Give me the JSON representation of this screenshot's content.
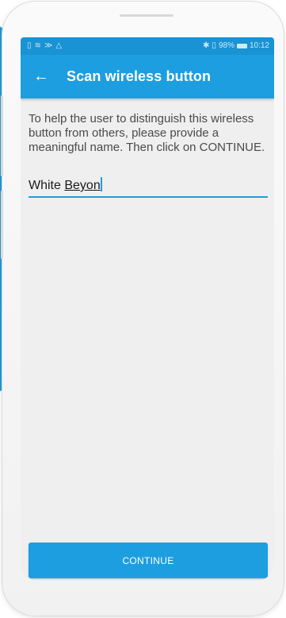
{
  "status_bar": {
    "left_icons": [
      "sim-icon",
      "wifi-icon",
      "cast-icon",
      "warning-icon"
    ],
    "left_glyphs": [
      "▯",
      "≋",
      "≫",
      "△"
    ],
    "bluetooth_glyph": "✱",
    "vibrate_glyph": "▯",
    "battery_percent": "98%",
    "time": "10:12"
  },
  "app_bar": {
    "back_glyph": "←",
    "title": "Scan wireless button"
  },
  "content": {
    "instructions": "To help the user to distinguish this wireless button from others, please provide a meaningful name. Then click on CONTINUE.",
    "name_field": {
      "prefix": "White ",
      "composing": "Beyon"
    }
  },
  "continue_label": "CONTINUE",
  "colors": {
    "primary": "#1d9ee0",
    "status_bar": "#1993d3",
    "screen_bg": "#efefef"
  }
}
